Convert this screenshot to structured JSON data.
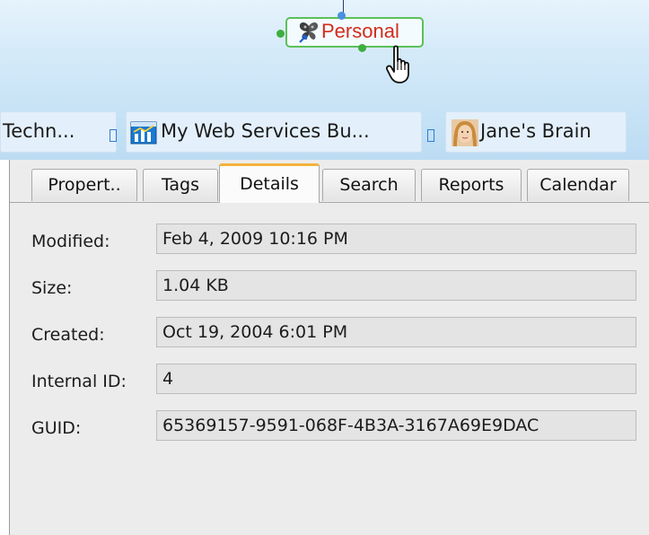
{
  "node": {
    "label": "Personal",
    "icon": "butterfly-icon",
    "label_color": "#d42c1c",
    "border_color": "#5cc05a"
  },
  "pins": [
    {
      "label": "Techn...",
      "icon": null
    },
    {
      "label": "My Web Services Bu...",
      "icon": "chart-icon"
    },
    {
      "label": "Jane's Brain",
      "icon": "face-photo-icon"
    }
  ],
  "tabs": [
    {
      "label": "Propert..",
      "active": false
    },
    {
      "label": "Tags",
      "active": false
    },
    {
      "label": "Details",
      "active": true
    },
    {
      "label": "Search",
      "active": false
    },
    {
      "label": "Reports",
      "active": false
    },
    {
      "label": "Calendar",
      "active": false
    }
  ],
  "details": [
    {
      "label": "Modified:",
      "value": "Feb 4, 2009 10:16 PM"
    },
    {
      "label": "Size:",
      "value": "1.04 KB"
    },
    {
      "label": "Created:",
      "value": "Oct 19, 2004 6:01 PM"
    },
    {
      "label": "Internal ID:",
      "value": "4"
    },
    {
      "label": "GUID:",
      "value": "65369157-9591-068F-4B3A-3167A69E9DAC"
    }
  ],
  "colors": {
    "active_tab_accent": "#f3b23a",
    "pin_separator": "#2e7bd6"
  }
}
